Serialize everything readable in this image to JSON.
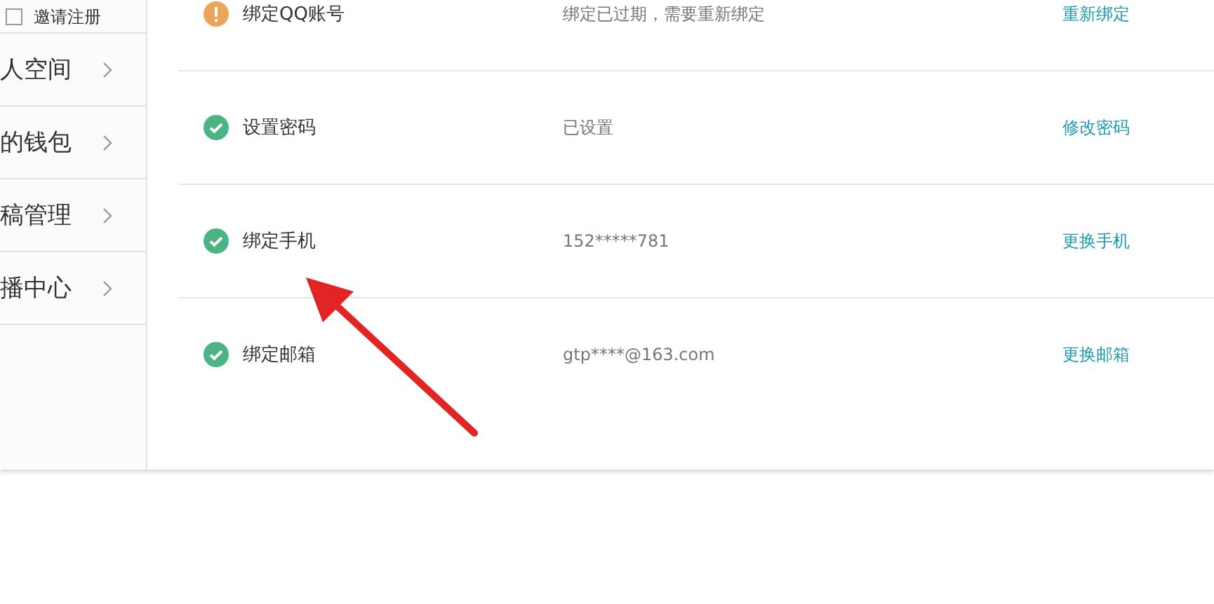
{
  "sidebar": {
    "items": [
      {
        "label": "邀请注册",
        "kind": "checkbox",
        "selected": false
      },
      {
        "label": "人空间",
        "kind": "link",
        "selected": false
      },
      {
        "label": "的钱包",
        "kind": "link",
        "selected": false
      },
      {
        "label": "稿管理",
        "kind": "link",
        "selected": false
      },
      {
        "label": "播中心",
        "kind": "link",
        "selected": false
      }
    ]
  },
  "security_items": [
    {
      "label": "绑定QQ账号",
      "verified": false,
      "detail": "绑定已过期，需要重新绑定",
      "action": "重新绑定"
    },
    {
      "label": "设置密码",
      "verified": true,
      "detail": "已设置",
      "action": "修改密码"
    },
    {
      "label": "绑定手机",
      "verified": true,
      "detail": "152*****781",
      "action": "更换手机"
    },
    {
      "label": "绑定邮箱",
      "verified": true,
      "detail": "gtp****@163.com",
      "action": "更换邮箱"
    }
  ]
}
